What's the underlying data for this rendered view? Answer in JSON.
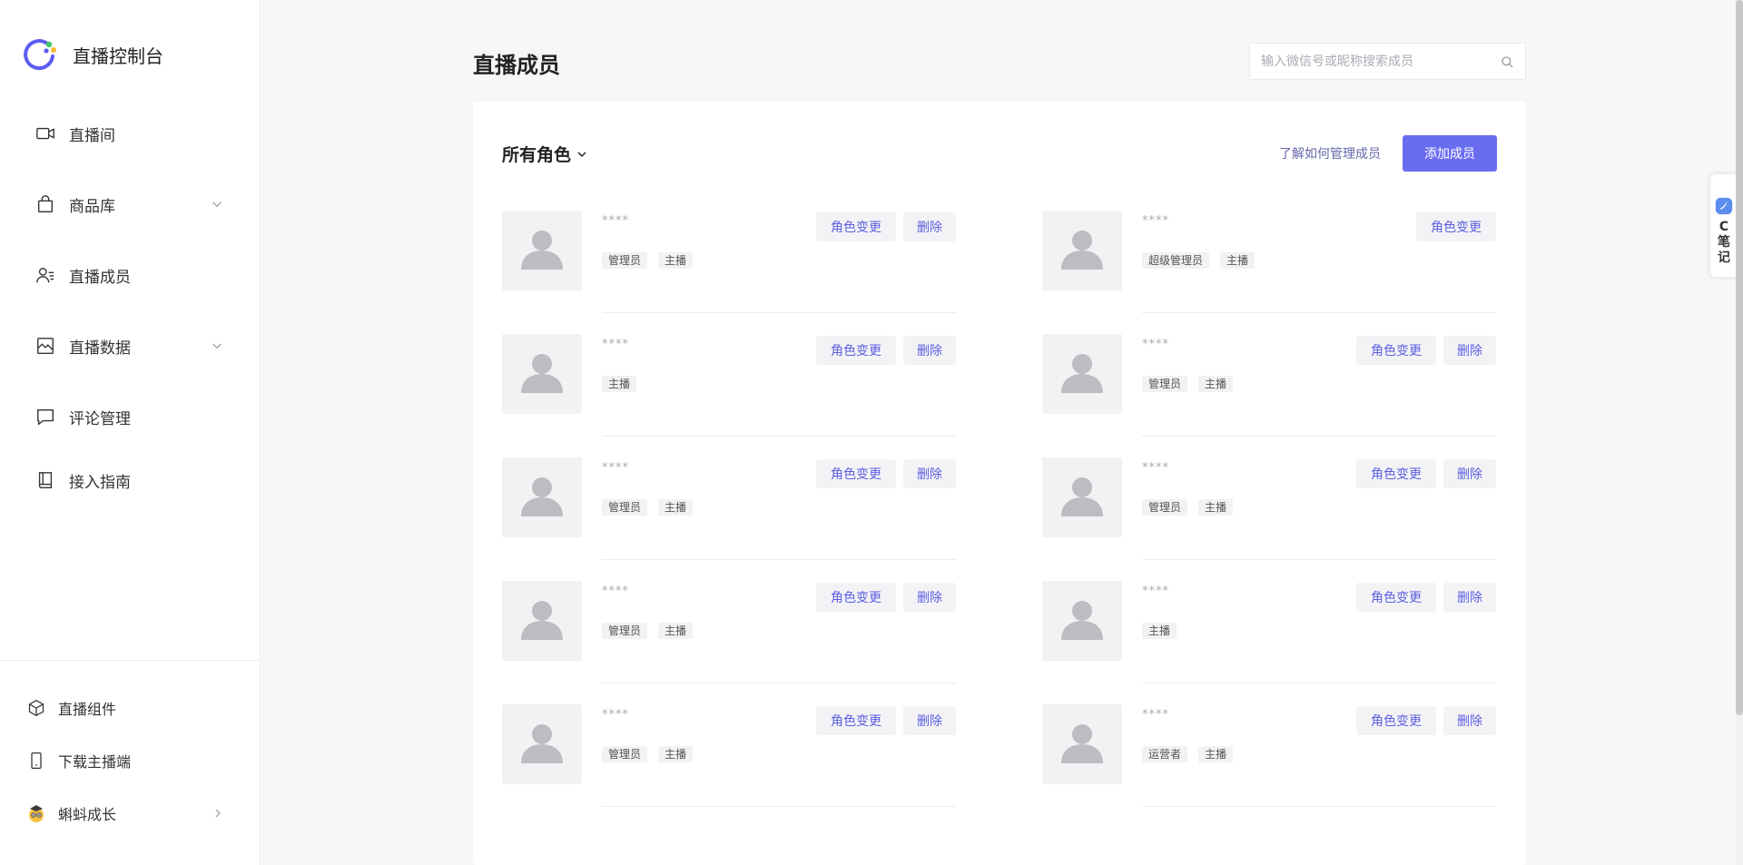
{
  "brand": {
    "title": "直播控制台",
    "colors": {
      "ring": "#5b5df0",
      "dot_green": "#44c767",
      "dot_yellow": "#f5b82e"
    }
  },
  "sidebar": {
    "items": [
      {
        "label": "直播间",
        "icon": "video-camera-icon",
        "has_submenu": false
      },
      {
        "label": "商品库",
        "icon": "shopping-bag-icon",
        "has_submenu": true
      },
      {
        "label": "直播成员",
        "icon": "user-list-icon",
        "has_submenu": false
      },
      {
        "label": "直播数据",
        "icon": "chart-image-icon",
        "has_submenu": true
      },
      {
        "label": "评论管理",
        "icon": "comment-icon",
        "has_submenu": false
      },
      {
        "label": "接入指南",
        "icon": "book-icon",
        "has_submenu": false
      }
    ],
    "bottom_items": [
      {
        "label": "直播组件",
        "icon": "cube-icon"
      },
      {
        "label": "下载主播端",
        "icon": "phone-icon"
      },
      {
        "label": "蝌蚪成长",
        "icon": "tadpole-avatar-icon"
      }
    ]
  },
  "header": {
    "title": "直播成员",
    "search_placeholder": "输入微信号或昵称搜索成员"
  },
  "toolbar": {
    "role_filter": "所有角色",
    "learn_link": "了解如何管理成员",
    "add_button": "添加成员"
  },
  "actions": {
    "change_role": "角色变更",
    "delete": "删除"
  },
  "members": [
    {
      "name": "****",
      "roles": [
        "管理员",
        "主播"
      ],
      "can_delete": true
    },
    {
      "name": "****",
      "roles": [
        "主播"
      ],
      "can_delete": true
    },
    {
      "name": "****",
      "roles": [
        "管理员",
        "主播"
      ],
      "can_delete": true
    },
    {
      "name": "****",
      "roles": [
        "管理员",
        "主播"
      ],
      "can_delete": true
    },
    {
      "name": "****",
      "roles": [
        "管理员",
        "主播"
      ],
      "can_delete": true
    },
    {
      "name": "****",
      "roles": [
        "超级管理员",
        "主播"
      ],
      "can_delete": false
    },
    {
      "name": "****",
      "roles": [
        "管理员",
        "主播"
      ],
      "can_delete": true
    },
    {
      "name": "****",
      "roles": [
        "管理员",
        "主播"
      ],
      "can_delete": true
    },
    {
      "name": "****",
      "roles": [
        "主播"
      ],
      "can_delete": true
    },
    {
      "name": "****",
      "roles": [
        "运营者",
        "主播"
      ],
      "can_delete": true
    }
  ],
  "float_widget": {
    "text": "C笔记",
    "icon": "note-widget-icon"
  },
  "theme": {
    "accent": "#6a6cf0",
    "action_text": "#5c5fe0",
    "link": "#6567a8"
  }
}
